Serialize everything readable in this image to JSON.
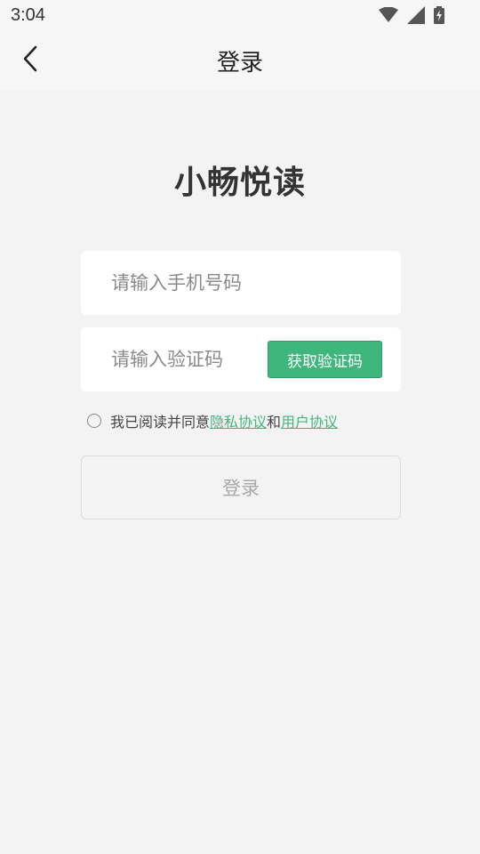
{
  "status_bar": {
    "time": "3:04",
    "icons": [
      "wifi-icon",
      "signal-icon",
      "battery-charging-icon"
    ]
  },
  "nav": {
    "back_icon": "chevron-left-icon",
    "title": "登录"
  },
  "app_title": "小畅悦读",
  "phone_field": {
    "placeholder": "请输入手机号码",
    "value": ""
  },
  "code_field": {
    "placeholder": "请输入验证码",
    "value": "",
    "button_label": "获取验证码"
  },
  "agreement": {
    "checked": false,
    "prefix": "我已阅读并同意",
    "privacy_link": "隐私协议",
    "joiner": "和",
    "user_link": "用户协议"
  },
  "login_button": {
    "label": "登录",
    "enabled": false
  },
  "colors": {
    "accent": "#3fb77c",
    "background": "#f3f3f3",
    "field_background": "#ffffff",
    "disabled_text": "#a8a8a8"
  }
}
